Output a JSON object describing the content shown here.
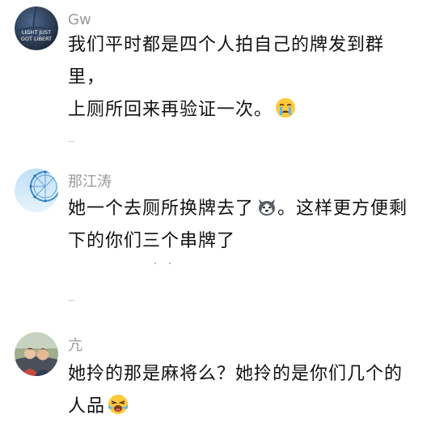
{
  "comments": [
    {
      "username": "Gw",
      "avatar": "basketball-avatar",
      "line1": "我们平时都是四个人拍自己的牌发到群里，",
      "line2": "上厕所回来再验证一次。",
      "emoji": "crying-face-emoji"
    },
    {
      "username": "那江涛",
      "avatar": "ferris-wheel-avatar",
      "line1": "她一个去厕所换牌去了",
      "line1_tail": "。这样更方便剩",
      "line2": "下的你们三个串牌了",
      "emoji": "husky-dog-emoji"
    },
    {
      "username": "亢",
      "avatar": "couple-photo-avatar",
      "line1": "她拎的那是麻将么？她拎的是你们几个的",
      "line2": "人品",
      "emoji": "loudly-crying-face-emoji"
    }
  ]
}
